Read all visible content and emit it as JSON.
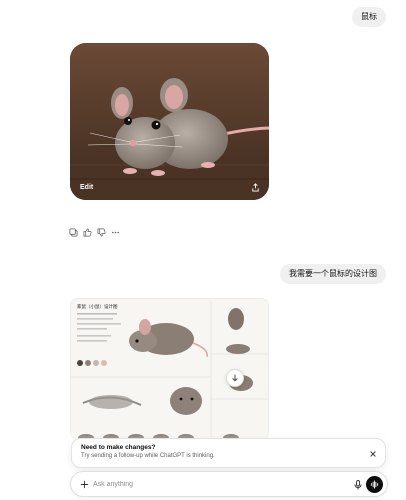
{
  "conversation": {
    "user_message_1": "鼠标",
    "user_message_2": "我需要一个鼠标的设计图"
  },
  "image_card": {
    "edit_label": "Edit"
  },
  "design_sheet": {
    "title": "家鼠（小鼠）设计图"
  },
  "notice": {
    "title": "Need to make changes?",
    "subtitle": "Try sending a follow-up while ChatGPT is thinking."
  },
  "composer": {
    "placeholder": "Ask anything"
  }
}
